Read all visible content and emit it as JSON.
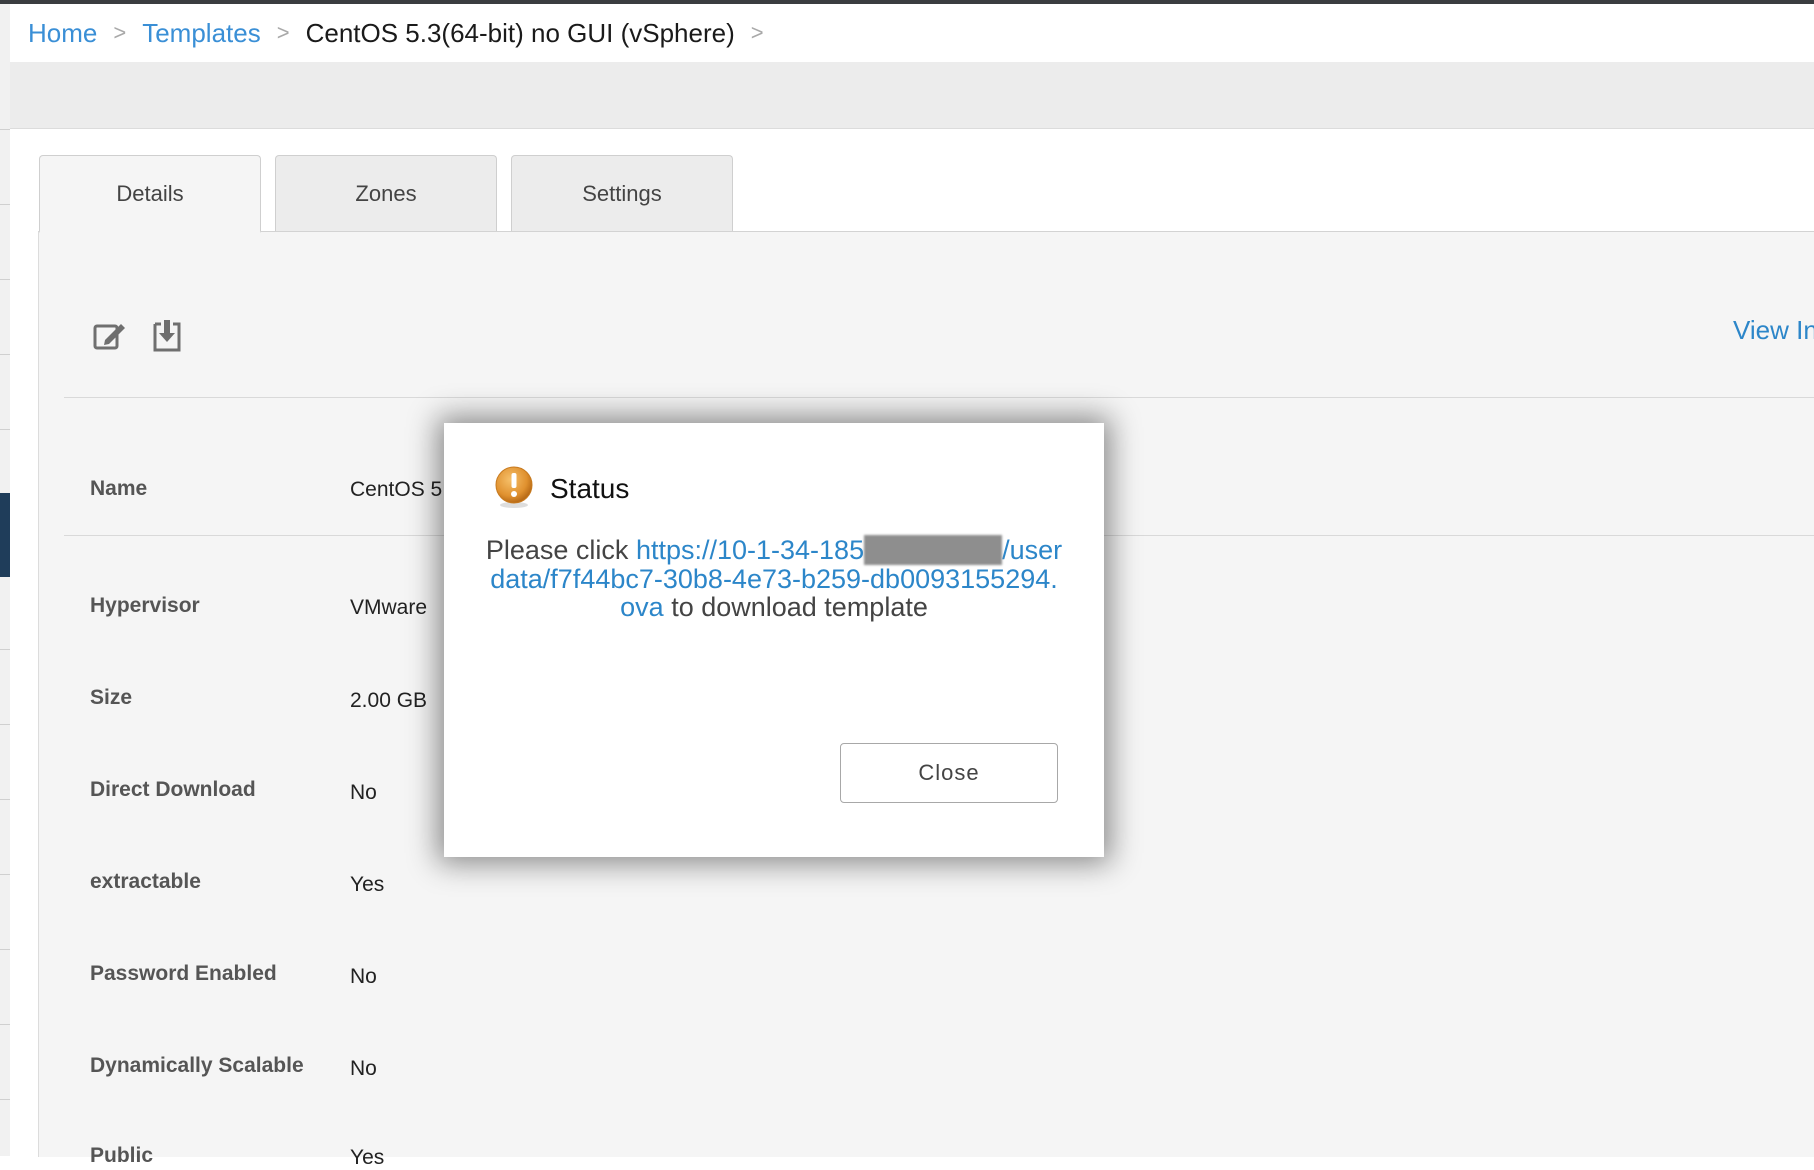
{
  "breadcrumb": {
    "home": "Home",
    "separator": ">",
    "templates": "Templates",
    "current": "CentOS 5.3(64-bit) no GUI (vSphere)"
  },
  "tabs": [
    {
      "label": "Details",
      "active": true
    },
    {
      "label": "Zones",
      "active": false
    },
    {
      "label": "Settings",
      "active": false
    }
  ],
  "toolbar": {
    "edit_icon": "edit-icon",
    "download_icon": "download-icon",
    "view_link": "View In"
  },
  "details": [
    {
      "label": "Name",
      "value": "CentOS 5"
    },
    {
      "label": "Hypervisor",
      "value": "VMware"
    },
    {
      "label": "Size",
      "value": "2.00 GB"
    },
    {
      "label": "Direct Download",
      "value": "No"
    },
    {
      "label": "extractable",
      "value": "Yes"
    },
    {
      "label": "Password Enabled",
      "value": "No"
    },
    {
      "label": "Dynamically Scalable",
      "value": "No"
    },
    {
      "label": "Public",
      "value": "Yes"
    }
  ],
  "dialog": {
    "title": "Status",
    "icon": "warning-icon",
    "message_prefix": "Please click",
    "link_part1": "https://10-1-34-185",
    "link_part2": "/userdata/f7f44bc7-30b8-4e73-b259-db0093155294.ova",
    "message_suffix": "to download template",
    "close_label": "Close"
  },
  "colors": {
    "link": "#2c86c9",
    "breadcrumb_link": "#3a8fd6",
    "warning": "#e0912f"
  }
}
